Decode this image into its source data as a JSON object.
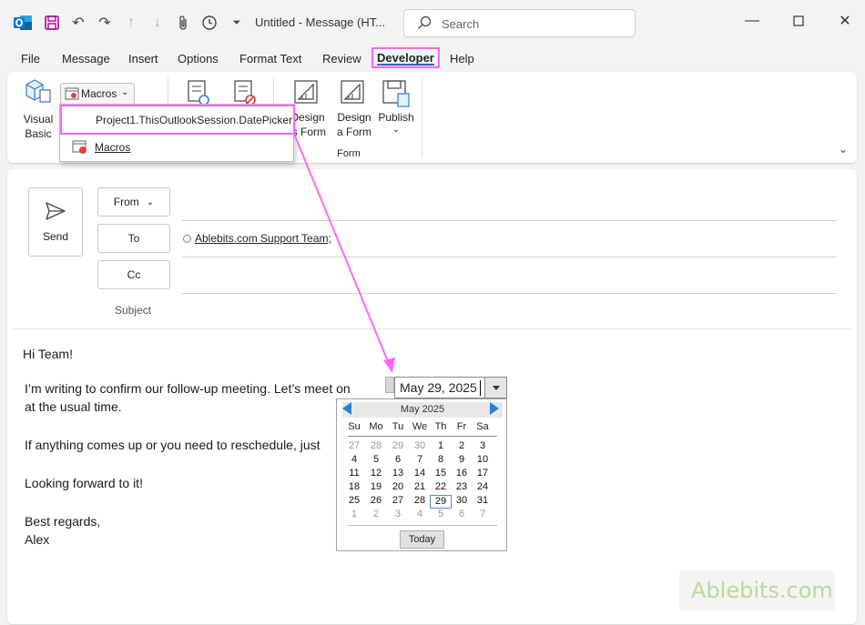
{
  "window": {
    "title": "Untitled - Message (HT...",
    "search_placeholder": "Search"
  },
  "menu": {
    "tabs": [
      "File",
      "Message",
      "Insert",
      "Options",
      "Format Text",
      "Review",
      "Developer",
      "Help"
    ],
    "active": "Developer"
  },
  "ribbon": {
    "visual_basic_line1": "Visual",
    "visual_basic_line2": "Basic",
    "macros_label": "Macros",
    "design_this_form_line1": "Design",
    "design_this_form_line2": "is Form",
    "design_a_form_line1": "Design",
    "design_a_form_line2": "a Form",
    "publish_label": "Publish",
    "form_group_label": "Form"
  },
  "macros_dropdown": {
    "item1": "Project1.ThisOutlookSession.DatePicker",
    "item2": "Macros"
  },
  "compose": {
    "send_label": "Send",
    "from_label": "From",
    "to_label": "To",
    "cc_label": "Cc",
    "subject_label": "Subject",
    "recipient": "Ablebits.com Support Team;"
  },
  "body": {
    "greeting": "Hi Team!",
    "line1": "I’m writing to confirm our follow-up meeting. Let’s meet on",
    "line2": "at the usual time.",
    "line3": "If anything comes up or you need to reschedule, just",
    "line4": "Looking forward to it!",
    "line5": "Best regards,",
    "line6": "Alex"
  },
  "date_picker": {
    "value": "May 29, 2025",
    "month_label": "May 2025",
    "days_of_week": [
      "Su",
      "Mo",
      "Tu",
      "We",
      "Th",
      "Fr",
      "Sa"
    ],
    "weeks": [
      [
        {
          "d": "27",
          "o": true
        },
        {
          "d": "28",
          "o": true
        },
        {
          "d": "29",
          "o": true
        },
        {
          "d": "30",
          "o": true
        },
        {
          "d": "1"
        },
        {
          "d": "2"
        },
        {
          "d": "3"
        }
      ],
      [
        {
          "d": "4"
        },
        {
          "d": "5"
        },
        {
          "d": "6"
        },
        {
          "d": "7"
        },
        {
          "d": "8"
        },
        {
          "d": "9"
        },
        {
          "d": "10"
        }
      ],
      [
        {
          "d": "11"
        },
        {
          "d": "12"
        },
        {
          "d": "13"
        },
        {
          "d": "14"
        },
        {
          "d": "15"
        },
        {
          "d": "16"
        },
        {
          "d": "17"
        }
      ],
      [
        {
          "d": "18"
        },
        {
          "d": "19"
        },
        {
          "d": "20"
        },
        {
          "d": "21"
        },
        {
          "d": "22"
        },
        {
          "d": "23"
        },
        {
          "d": "24"
        }
      ],
      [
        {
          "d": "25"
        },
        {
          "d": "26"
        },
        {
          "d": "27"
        },
        {
          "d": "28"
        },
        {
          "d": "29",
          "s": true
        },
        {
          "d": "30"
        },
        {
          "d": "31"
        }
      ],
      [
        {
          "d": "1",
          "o": true
        },
        {
          "d": "2",
          "o": true
        },
        {
          "d": "3",
          "o": true
        },
        {
          "d": "4",
          "o": true
        },
        {
          "d": "5",
          "o": true
        },
        {
          "d": "6",
          "o": true
        },
        {
          "d": "7",
          "o": true
        }
      ]
    ],
    "today_button": "Today"
  },
  "watermark": "Ablebits.com",
  "colors": {
    "highlight": "#ff66ff",
    "accent": "#0f6cbd",
    "watermark": "#b6dc9a"
  }
}
